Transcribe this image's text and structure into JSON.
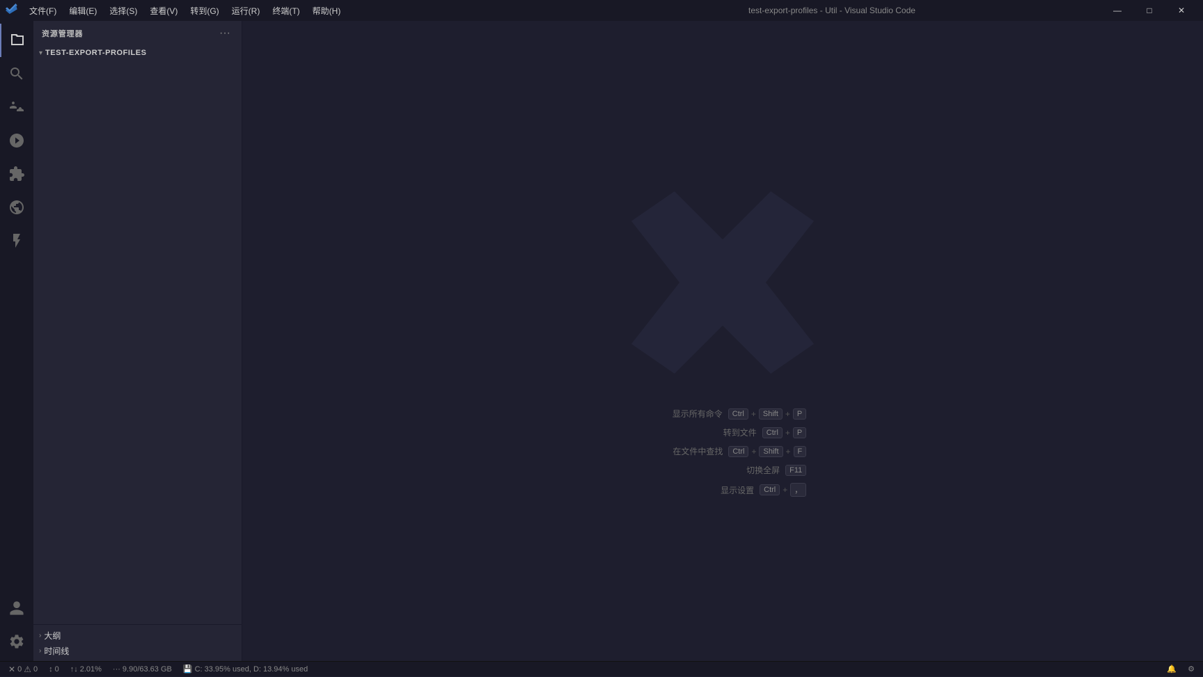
{
  "titleBar": {
    "title": "test-export-profiles - Util - Visual Studio Code",
    "menu": [
      "文件(F)",
      "编辑(E)",
      "选择(S)",
      "查看(V)",
      "转到(G)",
      "运行(R)",
      "终端(T)",
      "帮助(H)"
    ],
    "controls": [
      "—",
      "□",
      "✕"
    ]
  },
  "activityBar": {
    "items": [
      {
        "name": "explorer",
        "label": "资源管理器",
        "active": true
      },
      {
        "name": "search",
        "label": "搜索"
      },
      {
        "name": "source-control",
        "label": "源代码管理"
      },
      {
        "name": "run-debug",
        "label": "运行和调试"
      },
      {
        "name": "extensions",
        "label": "扩展"
      },
      {
        "name": "remote",
        "label": "远程"
      },
      {
        "name": "lightning",
        "label": "Lightning"
      }
    ],
    "bottom": [
      {
        "name": "account",
        "label": "账户"
      },
      {
        "name": "settings",
        "label": "管理"
      }
    ]
  },
  "sidebar": {
    "title": "资源管理器",
    "moreButton": "···",
    "explorerSection": {
      "label": "TEST-EXPORT-PROFILES",
      "expanded": true
    },
    "bottomSections": [
      {
        "label": "大纲"
      },
      {
        "label": "时间线"
      }
    ]
  },
  "editor": {
    "shortcuts": [
      {
        "label": "显示所有命令",
        "keys": [
          "Ctrl",
          "+",
          "Shift",
          "+",
          "P"
        ]
      },
      {
        "label": "转到文件",
        "keys": [
          "Ctrl",
          "+",
          "P"
        ]
      },
      {
        "label": "在文件中查找",
        "keys": [
          "Ctrl",
          "+",
          "Shift",
          "+",
          "F"
        ]
      },
      {
        "label": "切换全屏",
        "keys": [
          "F11"
        ]
      },
      {
        "label": "显示设置",
        "keys": [
          "Ctrl",
          "+",
          "，"
        ]
      }
    ]
  },
  "statusBar": {
    "items": [
      {
        "icon": "✕",
        "text": "",
        "count": ""
      },
      {
        "icon": "⚠",
        "text": "0"
      },
      {
        "icon": "⚠",
        "text": "0"
      },
      {
        "icon": "↕",
        "text": "0"
      },
      {
        "icon": "↑↓",
        "text": "2.01%"
      },
      {
        "icon": "···",
        "text": "9.90/63.63 GB"
      },
      {
        "icon": "💾",
        "text": "C: 33.95% used, D: 13.94% used"
      }
    ],
    "rightItems": [
      {
        "text": "🔔"
      },
      {
        "text": "⚙"
      }
    ]
  }
}
